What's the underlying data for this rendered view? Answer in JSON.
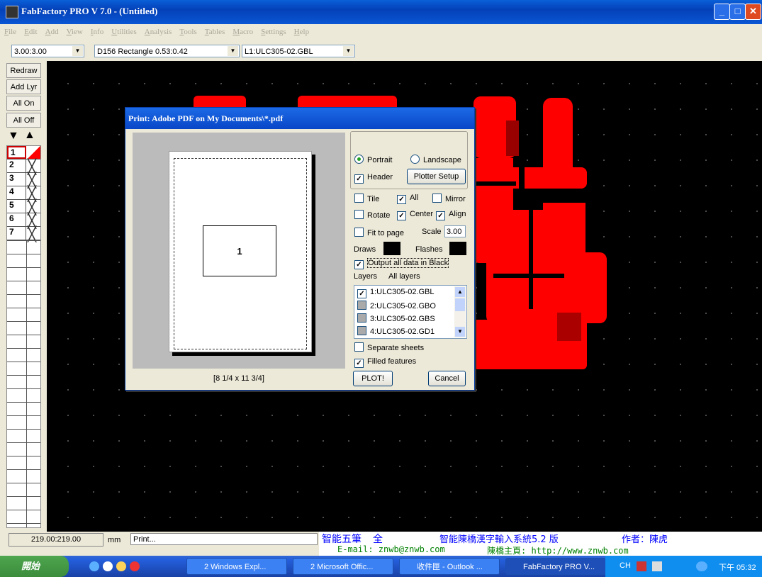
{
  "window": {
    "title": "FabFactory PRO V 7.0 - (Untitled)"
  },
  "menu": [
    "File",
    "Edit",
    "Add",
    "View",
    "Info",
    "Utilities",
    "Analysis",
    "Tools",
    "Tables",
    "Macro",
    "Settings",
    "Help"
  ],
  "toolbar": {
    "scale_value": "3.00:3.00",
    "dcode_value": "D156 Rectangle 0.53:0.42",
    "layer_value": "L1:ULC305-02.GBL"
  },
  "left_panel": {
    "buttons": [
      "Redraw",
      "Add Lyr",
      "All On",
      "All Off"
    ],
    "layer_numbers": [
      "1",
      "2",
      "3",
      "4",
      "5",
      "6",
      "7"
    ]
  },
  "dialog": {
    "title": "Print: Adobe PDF on My Documents\\*.pdf",
    "preview_tile": "1",
    "paper_size": "[8 1/4 x 11 3/4]",
    "portrait": "Portrait",
    "landscape": "Landscape",
    "header": "Header",
    "plotter_setup": "Plotter Setup",
    "tile": "Tile",
    "all": "All",
    "mirror": "Mirror",
    "rotate": "Rotate",
    "center": "Center",
    "align": "Align",
    "fit_to_page": "Fit to page",
    "scale_label": "Scale",
    "scale_value": "3.00",
    "draws": "Draws",
    "flashes": "Flashes",
    "output_black": "Output all data in Black",
    "layers_label": "Layers",
    "layers_value": "All layers",
    "layers": [
      "1:ULC305-02.GBL",
      "2:ULC305-02.GBO",
      "3:ULC305-02.GBS",
      "4:ULC305-02.GD1"
    ],
    "separate_sheets": "Separate sheets",
    "filled_features": "Filled features",
    "plot": "PLOT!",
    "cancel": "Cancel"
  },
  "status": {
    "coords": "219.00:219.00",
    "units": "mm",
    "message": "Print..."
  },
  "ime": {
    "line1": "智能五筆",
    "line1b": "全",
    "line1c": "智能陳橋漢字輸入系統5.2 版",
    "line1d": "作者：陳虎",
    "line2": "E-mail: znwb@znwb.com",
    "line2b": "陳橋主頁: http://www.znwb.com"
  },
  "taskbar": {
    "start": "開始",
    "tasks": [
      "2 Windows Expl...",
      "2 Microsoft Offic...",
      "收件匣 - Outlook ...",
      "FabFactory PRO V..."
    ],
    "lang": "CH",
    "clock": "下午 05:32"
  },
  "colors": {
    "pcb": "#ff0000",
    "titlebar": "#0a56d4",
    "panel": "#ece9d8"
  }
}
